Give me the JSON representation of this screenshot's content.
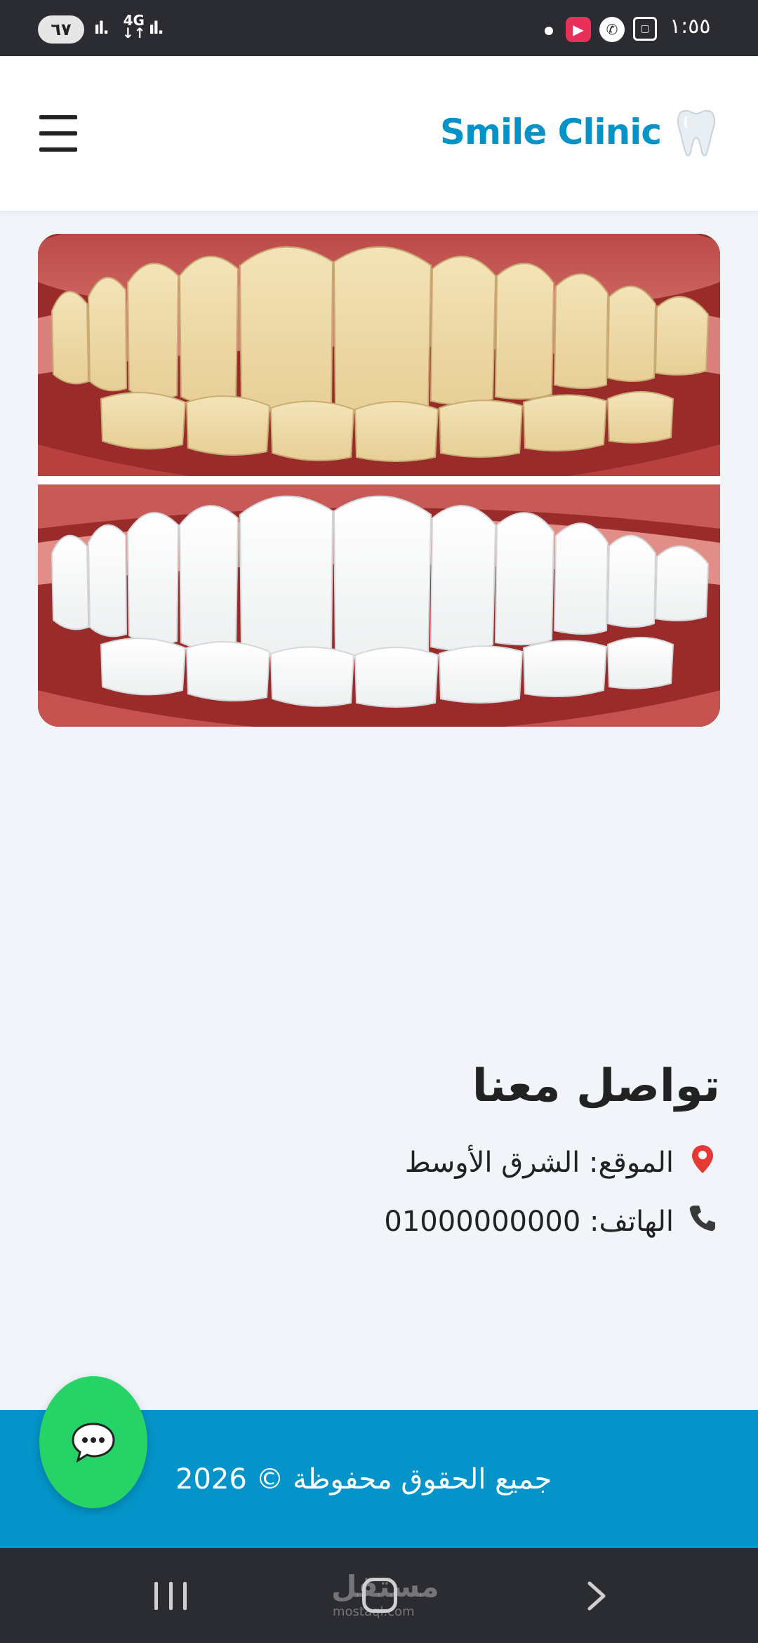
{
  "status_bar": {
    "battery": "٦٧",
    "network_type": "4G",
    "clock": "١:٥٥",
    "icons": [
      "signal-icon",
      "data-arrows-icon",
      "dot-icon",
      "app-notification-icon",
      "whatsapp-icon",
      "screenshot-icon"
    ]
  },
  "header": {
    "brand_name": "Smile Clinic",
    "brand_icon": "tooth-icon",
    "menu_icon": "hamburger-menu-icon",
    "brand_color": "#0592c7"
  },
  "hero": {
    "image": "teeth-whitening-before-after"
  },
  "contact": {
    "title": "تواصل معنا",
    "location_label": "الموقع: الشرق الأوسط",
    "phone_label": "الهاتف: 01000000000",
    "location_icon": "map-pin-icon",
    "phone_icon": "phone-icon"
  },
  "footer": {
    "copyright": "جميع الحقوق محفوظة © 2026",
    "background": "#0494c9"
  },
  "chat_button": {
    "icon": "chat-bubble-icon",
    "color": "#25d366"
  },
  "nav_bar": {
    "watermark": "مستقل",
    "watermark_sub": "mostaql.com"
  }
}
